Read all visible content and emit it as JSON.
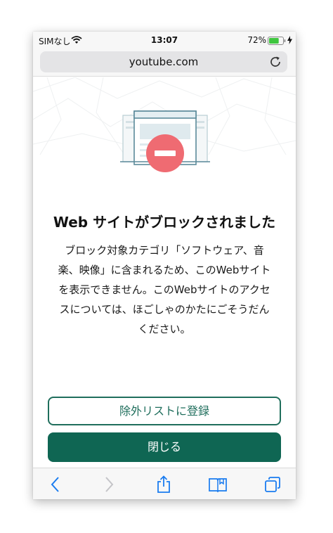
{
  "status_bar": {
    "carrier": "SIMなし",
    "time": "13:07",
    "battery_percent": "72%",
    "battery_level": 0.72
  },
  "browser": {
    "url": "youtube.com"
  },
  "block_page": {
    "headline": "Web サイトがブロックされました",
    "message_lines": [
      "ブロック対象カテゴリ「ソフトウェア、音",
      "楽、映像」に含まれるため、このWebサイト",
      "を表示できません。このWebサイトのアクセ",
      "スについては、ほごしゃのかたにごそうだん",
      "ください。"
    ],
    "add_to_exclusion_label": "除外リストに登録",
    "close_label": "閉じる"
  },
  "colors": {
    "accent": "#0f6653",
    "block_icon": "#ef6b72",
    "illustration_stroke": "#5b8a9a"
  },
  "toolbar_icons": [
    "back-icon",
    "forward-icon",
    "share-icon",
    "bookmarks-icon",
    "tabs-icon"
  ]
}
